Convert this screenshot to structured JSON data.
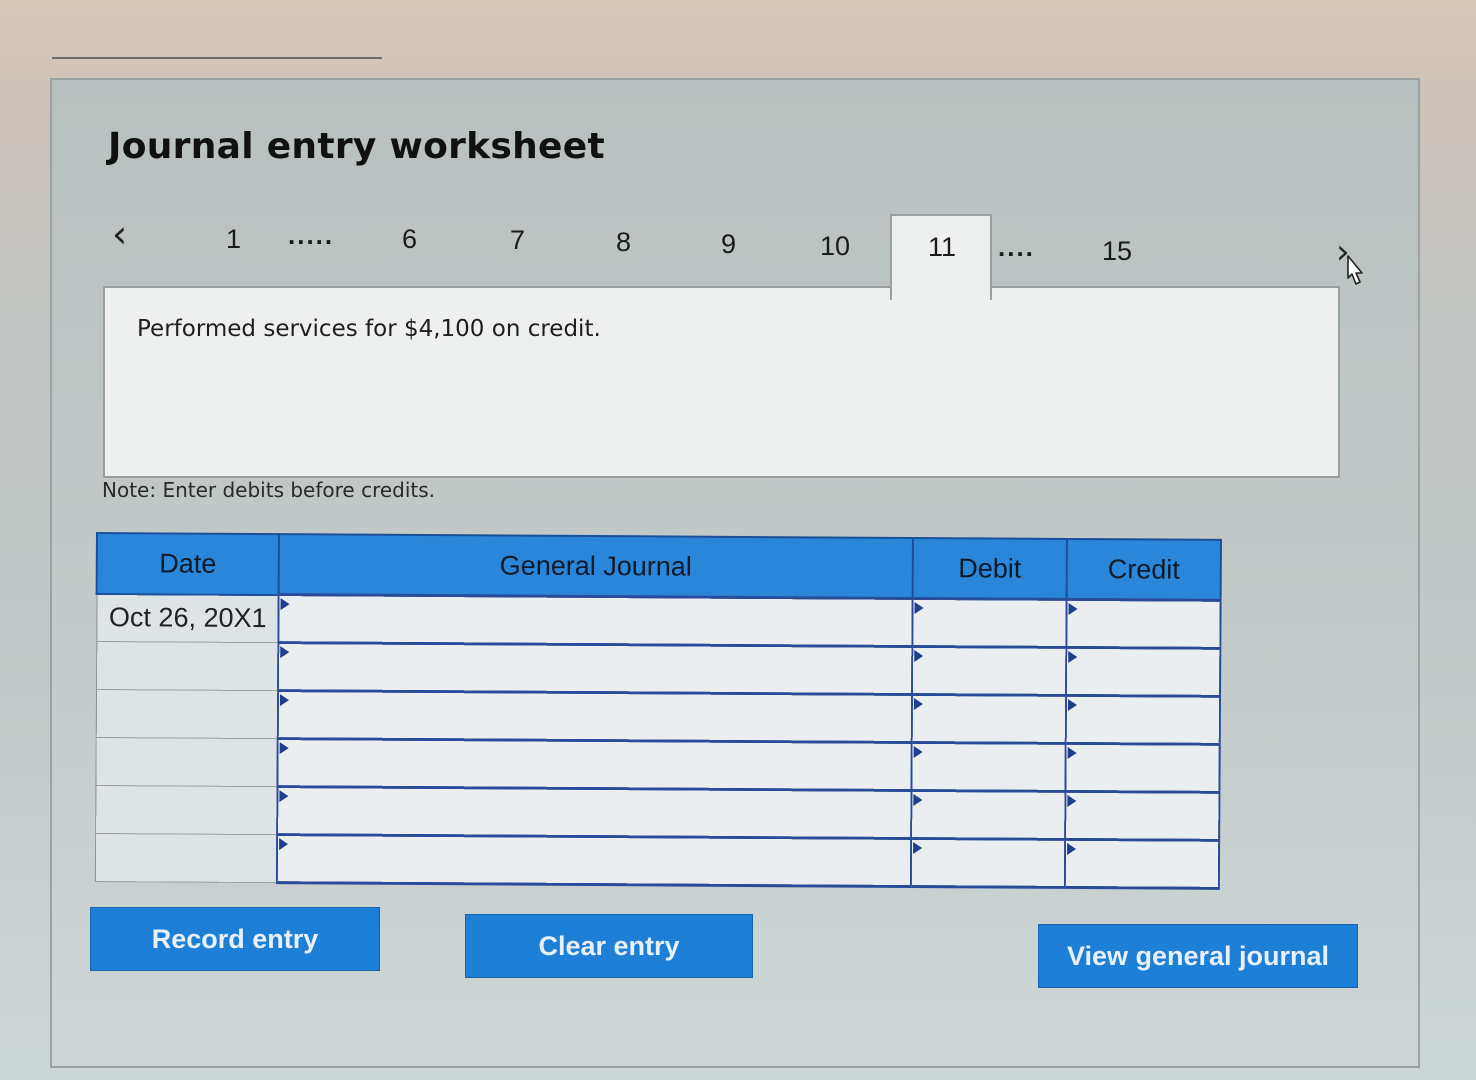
{
  "worksheet": {
    "title": "Journal entry worksheet"
  },
  "pager": {
    "prev_icon": "chevron-left-icon",
    "next_icon": "chevron-right-icon",
    "first": "1",
    "dots_left": ".....",
    "pages": [
      "6",
      "7",
      "8",
      "9",
      "10"
    ],
    "active": "11",
    "dots_right": "....",
    "last": "15"
  },
  "question": {
    "text": "Performed services for $4,100 on credit."
  },
  "note": "Note: Enter debits before credits.",
  "journal": {
    "headers": {
      "date": "Date",
      "general_journal": "General Journal",
      "debit": "Debit",
      "credit": "Credit"
    },
    "rows": [
      {
        "date": "Oct 26, 20X1",
        "account": "",
        "debit": "",
        "credit": ""
      },
      {
        "date": "",
        "account": "",
        "debit": "",
        "credit": ""
      },
      {
        "date": "",
        "account": "",
        "debit": "",
        "credit": ""
      },
      {
        "date": "",
        "account": "",
        "debit": "",
        "credit": ""
      },
      {
        "date": "",
        "account": "",
        "debit": "",
        "credit": ""
      },
      {
        "date": "",
        "account": "",
        "debit": "",
        "credit": ""
      }
    ]
  },
  "buttons": {
    "record": "Record entry",
    "clear": "Clear entry",
    "view": "View general journal"
  },
  "colors": {
    "header_blue": "#2a86d8",
    "button_blue": "#1d7fd6",
    "grid_border": "#2a4a9a"
  }
}
